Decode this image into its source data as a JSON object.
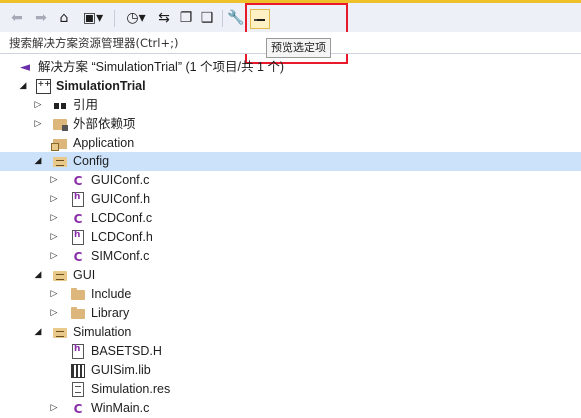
{
  "toolbar": {
    "back_icon": "arrow-left-icon",
    "forward_icon": "arrow-right-icon",
    "home_icon": "home-icon",
    "switch_views_icon": "switch-views-icon",
    "pending_changes_icon": "clock-icon",
    "sync_icon": "sync-icon",
    "collapse_icon": "collapse-all-icon",
    "show_all_icon": "show-all-files-icon",
    "properties_icon": "wrench-icon",
    "preview_icon": "preview-selected-icon"
  },
  "tooltip": {
    "text": "预览选定项"
  },
  "search": {
    "placeholder": "搜索解决方案资源管理器(Ctrl+;)"
  },
  "tree": [
    {
      "label": "解决方案 “SimulationTrial” (1 个项目/共 1 个)",
      "icon": "solution",
      "bold": false,
      "arrow": ""
    },
    {
      "label": "SimulationTrial",
      "icon": "project",
      "bold": true,
      "arrow": "down"
    },
    {
      "label": "引用",
      "icon": "references",
      "bold": false,
      "arrow": "right"
    },
    {
      "label": "外部依赖项",
      "icon": "external",
      "bold": false,
      "arrow": "right"
    },
    {
      "label": "Application",
      "icon": "app",
      "bold": false,
      "arrow": ""
    },
    {
      "label": "Config",
      "icon": "filter-folder",
      "bold": false,
      "arrow": "down",
      "selected": true
    },
    {
      "label": "GUIConf.c",
      "icon": "c",
      "bold": false,
      "arrow": "right"
    },
    {
      "label": "GUIConf.h",
      "icon": "h",
      "bold": false,
      "arrow": "right"
    },
    {
      "label": "LCDConf.c",
      "icon": "c",
      "bold": false,
      "arrow": "right"
    },
    {
      "label": "LCDConf.h",
      "icon": "h",
      "bold": false,
      "arrow": "right"
    },
    {
      "label": "SIMConf.c",
      "icon": "c",
      "bold": false,
      "arrow": "right"
    },
    {
      "label": "GUI",
      "icon": "filter-folder",
      "bold": false,
      "arrow": "down"
    },
    {
      "label": "Include",
      "icon": "folder",
      "bold": false,
      "arrow": "right"
    },
    {
      "label": "Library",
      "icon": "folder",
      "bold": false,
      "arrow": "right"
    },
    {
      "label": "Simulation",
      "icon": "filter-folder",
      "bold": false,
      "arrow": "down"
    },
    {
      "label": "BASETSD.H",
      "icon": "h",
      "bold": false,
      "arrow": ""
    },
    {
      "label": "GUISim.lib",
      "icon": "lib",
      "bold": false,
      "arrow": ""
    },
    {
      "label": "Simulation.res",
      "icon": "res",
      "bold": false,
      "arrow": ""
    },
    {
      "label": "WinMain.c",
      "icon": "c",
      "bold": false,
      "arrow": "right"
    }
  ],
  "colors": {
    "selection": "#cce2fb",
    "highlight_box": "#e8192b",
    "toolbar": "#eef0f8"
  }
}
